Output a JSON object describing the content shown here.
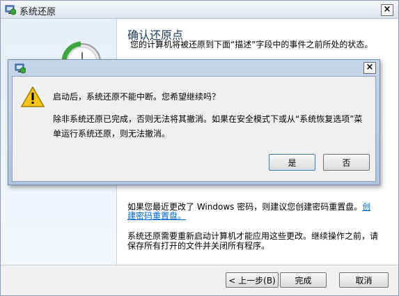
{
  "main_window": {
    "title": "系统还原",
    "close_label": "×",
    "heading": "确认还原点",
    "description": "您的计算机将被还原到下面“描述”字段中的事件之前所处的状态。",
    "password_note": "如果您最近更改了 Windows 密码，则建议您创建密码重置盘。",
    "password_link": "创建密码重置盘。",
    "restart_note": "系统还原需要重新启动计算机才能应用这些更改。继续操作之前，请保存所有打开的文件并关闭所有程序。",
    "buttons": {
      "back": "< 上一步(B)",
      "finish": "完成",
      "cancel": "取消"
    }
  },
  "dialog": {
    "close_label": "×",
    "question": "启动后，系统还原不能中断。您希望继续吗？",
    "detail": "除非系统还原已完成，否则无法将其撤消。如果在安全模式下或从“系统恢复选项”菜单运行系统还原，则无法撤消。",
    "buttons": {
      "yes": "是",
      "no": "否"
    }
  },
  "icons": {
    "title_icon": "system-restore-icon",
    "warning": "warning-icon",
    "restore_graphic": "restore-clock-icon"
  },
  "colors": {
    "heading": "#1e395b",
    "link": "#0066cc",
    "dialog_frame": "#aec4de",
    "warning": "#f5c518"
  }
}
